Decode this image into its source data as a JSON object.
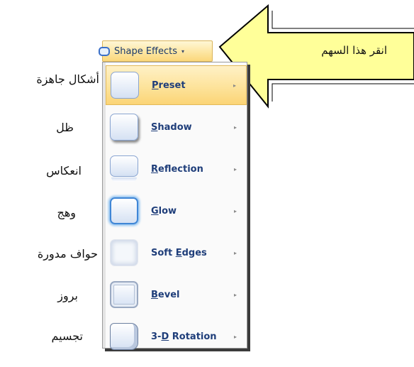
{
  "button": {
    "label": "Shape Effects",
    "caret": "▾",
    "icon": "shape-outline-icon"
  },
  "menu": {
    "items": [
      {
        "label": "Preset",
        "mnemonic": "P",
        "rest": "reset",
        "selected": true,
        "arrow": "▸",
        "icon": "preset-thumb"
      },
      {
        "label": "Shadow",
        "mnemonic": "S",
        "rest": "hadow",
        "selected": false,
        "arrow": "▸",
        "icon": "shadow-thumb"
      },
      {
        "label": "Reflection",
        "mnemonic": "R",
        "rest": "eflection",
        "selected": false,
        "arrow": "▸",
        "icon": "reflection-thumb"
      },
      {
        "label": "Glow",
        "mnemonic": "G",
        "rest": "low",
        "selected": false,
        "arrow": "▸",
        "icon": "glow-thumb"
      },
      {
        "label": "Soft Edges",
        "pre": "Soft ",
        "mnemonic": "E",
        "rest": "dges",
        "selected": false,
        "arrow": "▸",
        "icon": "soft-edges-thumb"
      },
      {
        "label": "Bevel",
        "mnemonic": "B",
        "rest": "evel",
        "selected": false,
        "arrow": "▸",
        "icon": "bevel-thumb"
      },
      {
        "label": "3-D Rotation",
        "pre": "3-",
        "mnemonic": "D",
        "rest": " Rotation",
        "selected": false,
        "arrow": "▸",
        "icon": "3d-rotation-thumb"
      }
    ]
  },
  "arabic_labels": [
    "أشكال جاهزة",
    "ظل",
    "انعكاس",
    "وهج",
    "حواف مدورة",
    "بروز",
    "تجسيم"
  ],
  "callout": {
    "text": "انقر هذا السهم"
  },
  "colors": {
    "highlight": "#fde39b",
    "menu_text": "#1f3e7a",
    "callout_fill": "#ffff99"
  }
}
